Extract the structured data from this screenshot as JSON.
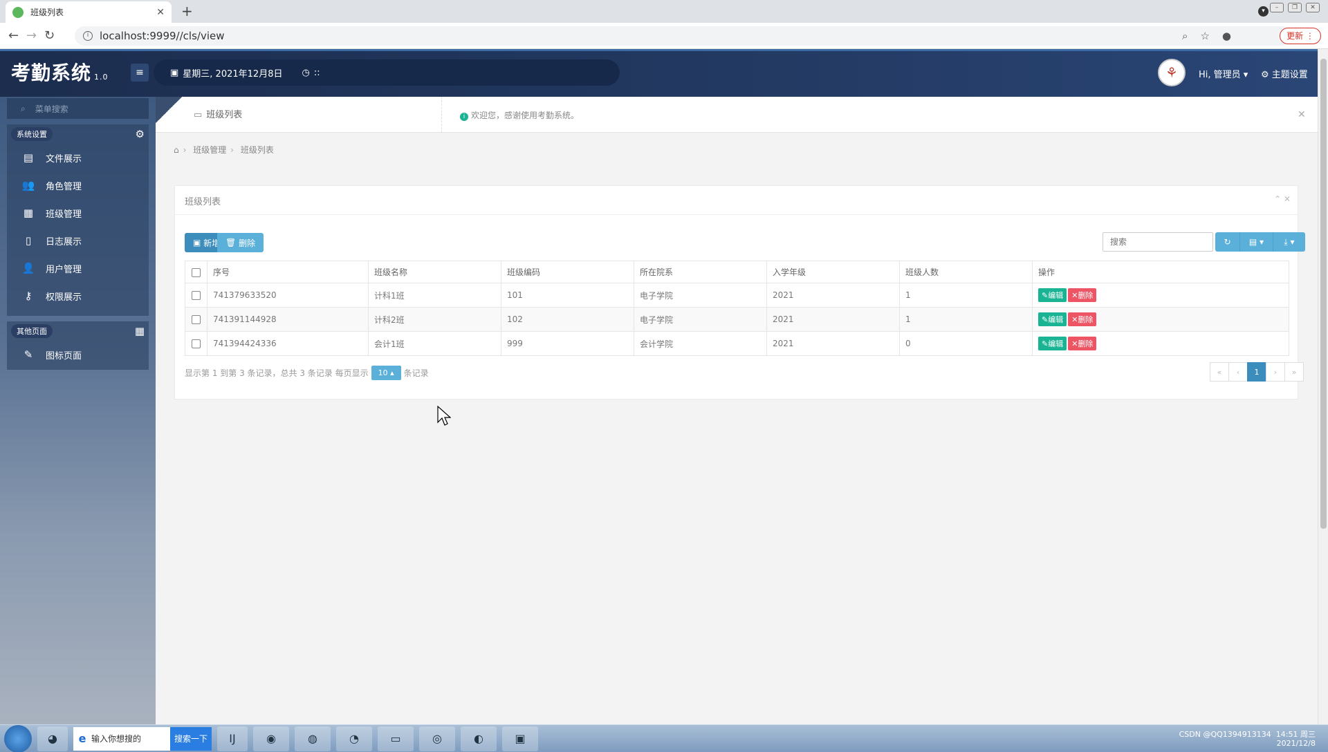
{
  "browser": {
    "tab_title": "班级列表",
    "url": "localhost:9999//cls/view",
    "update_label": "更新"
  },
  "header": {
    "brand": "考勤系统",
    "version": "1.0",
    "date": "星期三, 2021年12月8日",
    "time": "::",
    "user": "Hi, 管理员",
    "theme": "主题设置"
  },
  "sidebar": {
    "search_placeholder": "菜单搜索",
    "groups": [
      {
        "title": "系统设置",
        "items": [
          {
            "label": "文件展示",
            "icon": "file-image-icon"
          },
          {
            "label": "角色管理",
            "icon": "users-icon"
          },
          {
            "label": "班级管理",
            "icon": "grid-icon"
          },
          {
            "label": "日志展示",
            "icon": "log-icon"
          },
          {
            "label": "用户管理",
            "icon": "user-icon"
          },
          {
            "label": "权限展示",
            "icon": "key-icon"
          }
        ]
      },
      {
        "title": "其他页面",
        "items": [
          {
            "label": "图标页面",
            "icon": "magic-wand-icon"
          }
        ]
      }
    ]
  },
  "content": {
    "tab_label": "班级列表",
    "notice": "欢迎您，感谢使用考勤系统。",
    "breadcrumb": [
      "班级管理",
      "班级列表"
    ],
    "panel_title": "班级列表",
    "toolbar": {
      "add_label": "新增",
      "delete_label": "删除",
      "search_placeholder": "搜索"
    },
    "table": {
      "columns": [
        "序号",
        "班级名称",
        "班级编码",
        "所在院系",
        "入学年级",
        "班级人数",
        "操作"
      ],
      "rows": [
        [
          "741379633520",
          "计科1班",
          "101",
          "电子学院",
          "2021",
          "1"
        ],
        [
          "741391144928",
          "计科2班",
          "102",
          "电子学院",
          "2021",
          "1"
        ],
        [
          "741394424336",
          "会计1班",
          "999",
          "会计学院",
          "2021",
          "0"
        ]
      ],
      "edit_label": "编辑",
      "delete_label": "删除"
    },
    "pager": {
      "info_prefix": "显示第 1 到第 3 条记录，总共 3 条记录 每页显示",
      "page_size": "10",
      "info_suffix": "条记录",
      "current_page": "1"
    }
  },
  "taskbar": {
    "search_placeholder": "输入你想搜的",
    "search_button": "搜索一下",
    "clock": "14:51 周三",
    "date": "2021/12/8",
    "watermark": "CSDN @QQ1394913134"
  }
}
